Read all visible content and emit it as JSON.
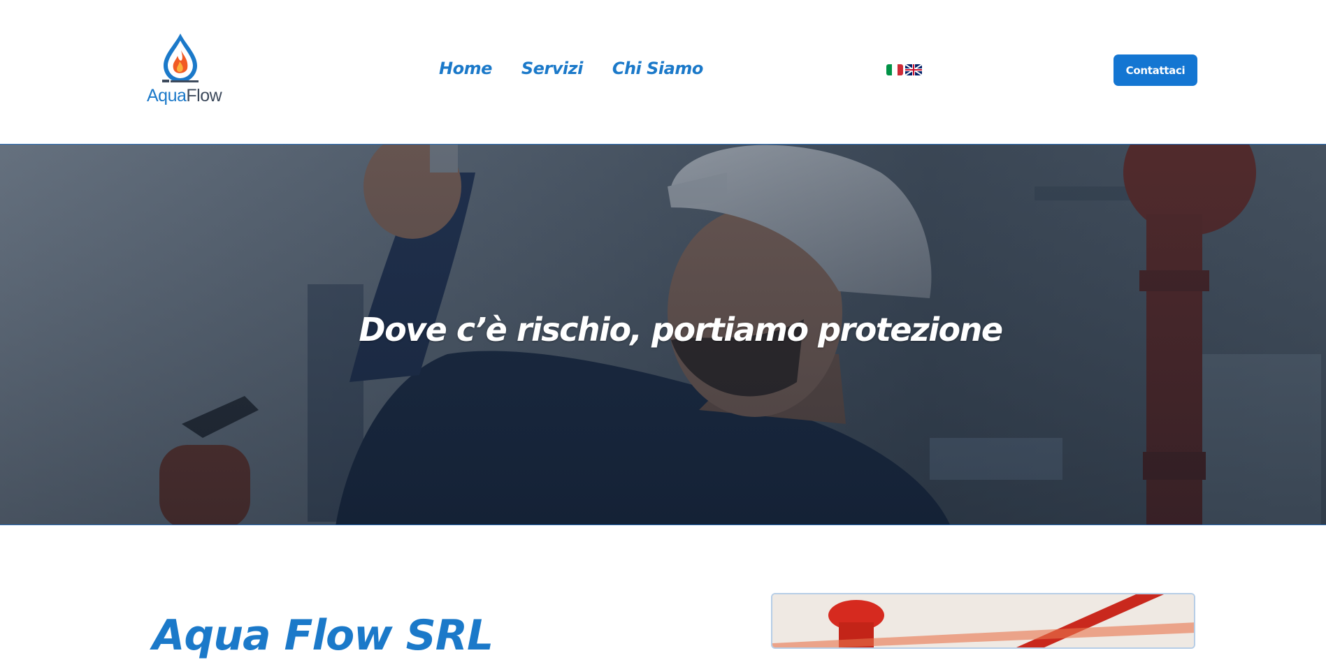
{
  "header": {
    "logo": {
      "text_part1": "Aqua",
      "text_part2": "Flow",
      "icon": "water-drop-flame-icon"
    },
    "nav": [
      {
        "label": "Home"
      },
      {
        "label": "Servizi"
      },
      {
        "label": "Chi Siamo"
      }
    ],
    "languages": [
      {
        "icon": "italy-flag-icon"
      },
      {
        "icon": "uk-flag-icon"
      }
    ],
    "contact_label": "Contattaci"
  },
  "hero": {
    "title": "Dove c’è rischio, portiamo protezione"
  },
  "about": {
    "title": "Aqua Flow SRL"
  },
  "colors": {
    "brand_blue": "#1b79c9",
    "button_blue": "#1476d2",
    "flame_orange": "#f15a24"
  }
}
